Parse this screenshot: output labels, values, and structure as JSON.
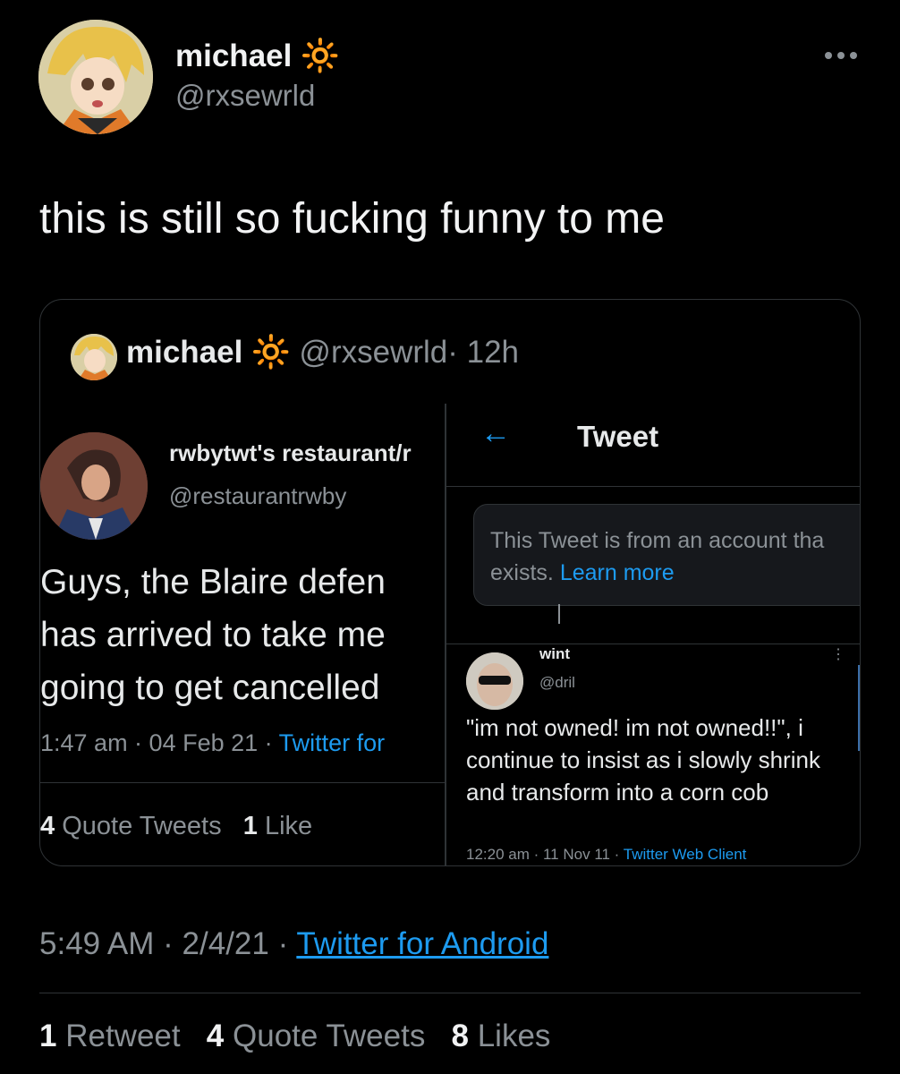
{
  "author": {
    "name": "michael",
    "name_emoji": "🔆",
    "handle": "@rxsewrld"
  },
  "tweet": {
    "text": "this is still so fucking funny to me",
    "time": "5:49 AM",
    "date": "2/4/21",
    "source": "Twitter for Android",
    "separator": "·"
  },
  "stats": {
    "retweets_count": "1",
    "retweets_label": "Retweet",
    "quotes_count": "4",
    "quotes_label": "Quote Tweets",
    "likes_count": "8",
    "likes_label": "Likes"
  },
  "quoted": {
    "name": "michael",
    "emoji": "🔆",
    "handle": "@rxsewrld",
    "age": "· 12h"
  },
  "left_screenshot": {
    "name": "rwbytwt's restaurant/r",
    "handle": "@restaurantrwby",
    "text_line1": "Guys, the Blaire defen",
    "text_line2": "has arrived to take me",
    "text_line3": "going to get cancelled",
    "time": "1:47 am · 04 Feb 21 · ",
    "source": "Twitter for",
    "quotes_count": "4",
    "quotes_label": "Quote Tweets",
    "likes_count": "1",
    "likes_label": "Like"
  },
  "right_screenshot": {
    "back_icon": "←",
    "title": "Tweet",
    "notice_text": "This Tweet is from an account tha exists.",
    "notice_link": "Learn more",
    "wint_name": "wint",
    "wint_handle": "@dril",
    "wint_text": "\"im not owned!  im not owned!!\", i continue to insist as i slowly shrink and transform into a corn cob",
    "wint_time": "12:20 am · 11 Nov 11 · ",
    "wint_source": "Twitter Web Client"
  },
  "icons": [
    "more-icon",
    "back-arrow-icon",
    "sun-emoji-icon"
  ],
  "colors": {
    "background": "#000000",
    "link": "#1d9bf0",
    "muted": "#8b9196",
    "border": "#2f3336"
  }
}
